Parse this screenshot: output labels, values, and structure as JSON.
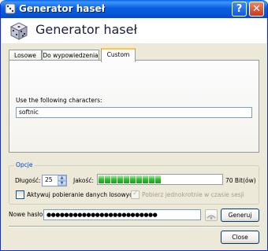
{
  "window": {
    "title": "Generator haseł"
  },
  "header": {
    "title": "Generator haseł"
  },
  "tabs": [
    {
      "label": "Losowe"
    },
    {
      "label": "Do wypowiedzenia"
    },
    {
      "label": "Custom"
    }
  ],
  "custom": {
    "chars_label": "Use the following characters:",
    "chars_value": "softnic"
  },
  "options": {
    "group_title": "Opcje",
    "length_label": "Długość:",
    "length_value": "25",
    "quality_label": "Jakość:",
    "quality_text": "70 Bit(ów)",
    "quality_fraction": 0.55,
    "active_download_label": "Aktywuj pobieranie danych losowych",
    "active_download_checked": false,
    "fetch_once_label": "Pobierz jednokrotnie w czasie sesji",
    "fetch_once_checked": true
  },
  "password": {
    "label": "Nowe hasło:",
    "value": "●●●●●●●●●●●●●●●●●●●●●●●●●",
    "generate_label": "Generuj"
  },
  "footer": {
    "close_label": "Close"
  },
  "colors": {
    "titlebar": "#0a5ee0",
    "quality_bar": "#2dbf2d",
    "group_title": "#0046d5"
  }
}
